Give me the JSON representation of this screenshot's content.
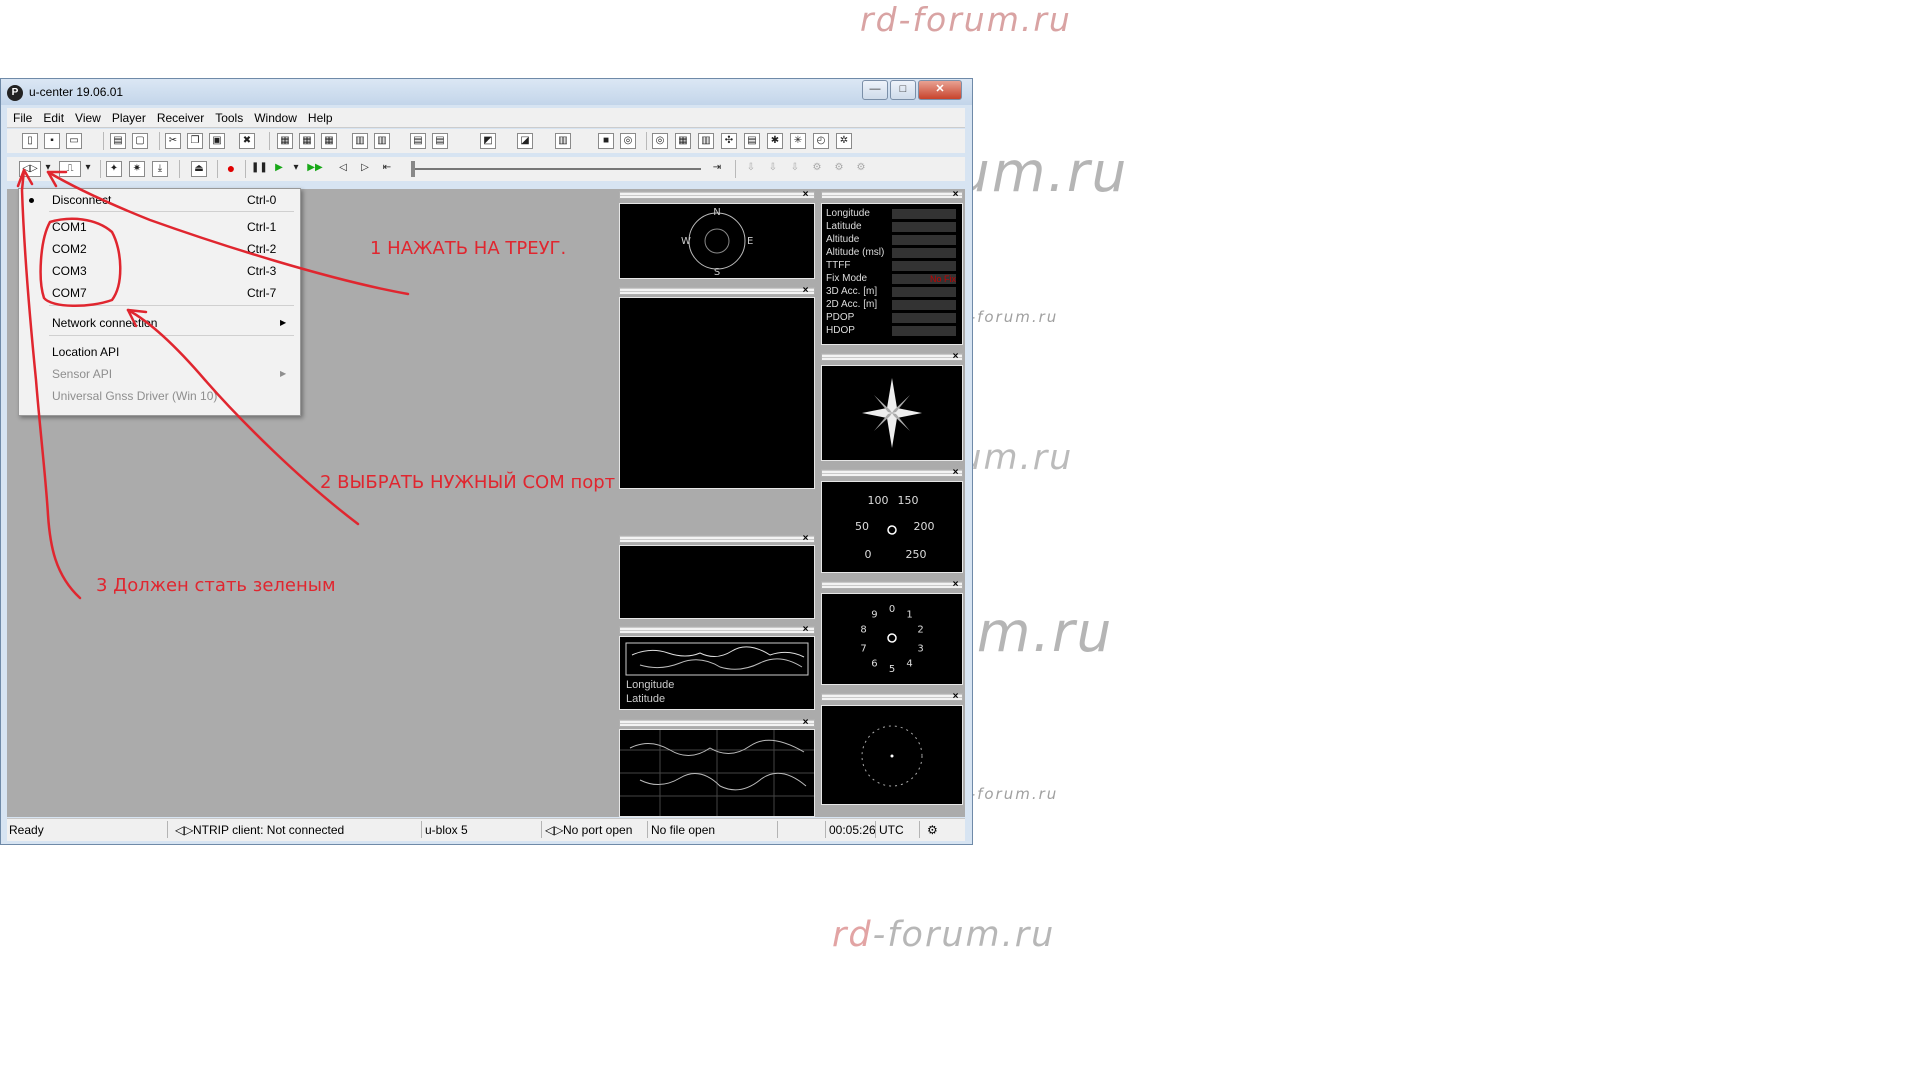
{
  "watermark": {
    "rd": "rd",
    "rest": "-forum.ru",
    "full": "rd-forum.ru"
  },
  "window": {
    "title": "u-center 19.06.01",
    "app_icon": "P",
    "buttons": {
      "minimize": "—",
      "maximize": "□",
      "close": "✕"
    }
  },
  "menu": [
    "File",
    "Edit",
    "View",
    "Player",
    "Receiver",
    "Tools",
    "Window",
    "Help"
  ],
  "dropdown": {
    "items": [
      {
        "label": "Disconnect",
        "shortcut": "Ctrl-0"
      },
      {
        "label": "COM1",
        "shortcut": "Ctrl-1"
      },
      {
        "label": "COM2",
        "shortcut": "Ctrl-2"
      },
      {
        "label": "COM3",
        "shortcut": "Ctrl-3"
      },
      {
        "label": "COM7",
        "shortcut": "Ctrl-7"
      },
      {
        "label": "Network connection"
      },
      {
        "label": "Location API"
      },
      {
        "label": "Sensor API"
      },
      {
        "label": "Universal Gnss Driver (Win 10)"
      }
    ]
  },
  "panes": {
    "skyview": {
      "n": "N",
      "s": "S",
      "e": "E",
      "w": "W"
    },
    "data_labels": [
      "Longitude",
      "Latitude",
      "Altitude",
      "Altitude (msl)",
      "TTFF",
      "Fix Mode",
      "3D Acc. [m]",
      "2D Acc. [m]",
      "PDOP",
      "HDOP"
    ],
    "fix_mode_value": "No Fix",
    "speed_labels": [
      "100",
      "150",
      "50",
      "200",
      "0",
      "250"
    ],
    "clock_labels": [
      "0",
      "1",
      "2",
      "3",
      "4",
      "5",
      "6",
      "7",
      "8",
      "9"
    ],
    "map_labels": {
      "longitude": "Longitude",
      "latitude": "Latitude"
    }
  },
  "status": {
    "ready": "Ready",
    "ntrip": "NTRIP client: Not connected",
    "receiver": "u-blox 5",
    "port": "No port open",
    "file": "No file open",
    "time": "00:05:26",
    "tz": "UTC"
  },
  "annotations": {
    "step1": "1 НАЖАТЬ НА ТРЕУГ.",
    "step2": "2 ВЫБРАТЬ НУЖНЫЙ СОМ порт",
    "step3": "3 Должен стать зеленым"
  },
  "colors": {
    "annotation": "#e0262f",
    "record": "#e00000",
    "play": "#18a818",
    "fix_mode": "#c00000"
  }
}
